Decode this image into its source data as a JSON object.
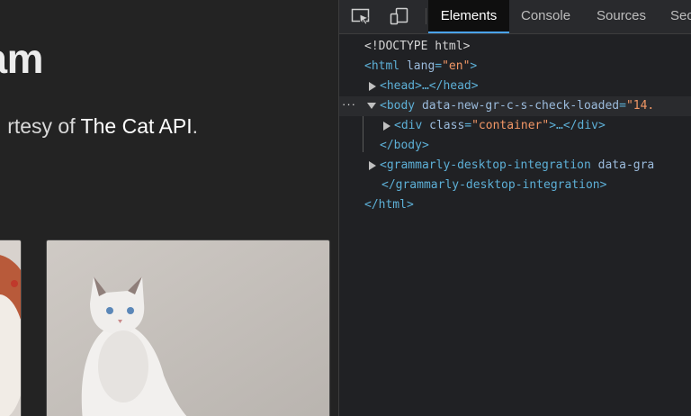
{
  "page": {
    "title": "am",
    "subtitle_prefix": "rtesy of ",
    "subtitle_link": "The Cat API",
    "subtitle_suffix": "."
  },
  "devtools": {
    "tabs": [
      "Elements",
      "Console",
      "Sources",
      "Sec"
    ],
    "active_tab": "Elements",
    "dom": {
      "doctype": "<!DOCTYPE html>",
      "html_open": "<html",
      "html_attr": "lang",
      "html_val": "\"en\"",
      "head": "<head>…</head>",
      "body_open": "<body",
      "body_attr": "data-new-gr-c-s-check-loaded",
      "body_val": "\"14.",
      "div_open": "<div",
      "div_attr": "class",
      "div_val": "\"container\"",
      "div_close": ">…</div>",
      "body_close": "</body>",
      "gram_open": "<grammarly-desktop-integration",
      "gram_attr": "data-gra",
      "gram_close": "</grammarly-desktop-integration>",
      "html_close": "</html>",
      "dots": "···"
    }
  },
  "colors": {
    "tag": "#5db0d7",
    "attribute": "#9bbbdc",
    "value": "#f29766",
    "active_tab_underline": "#4aa3f5"
  }
}
